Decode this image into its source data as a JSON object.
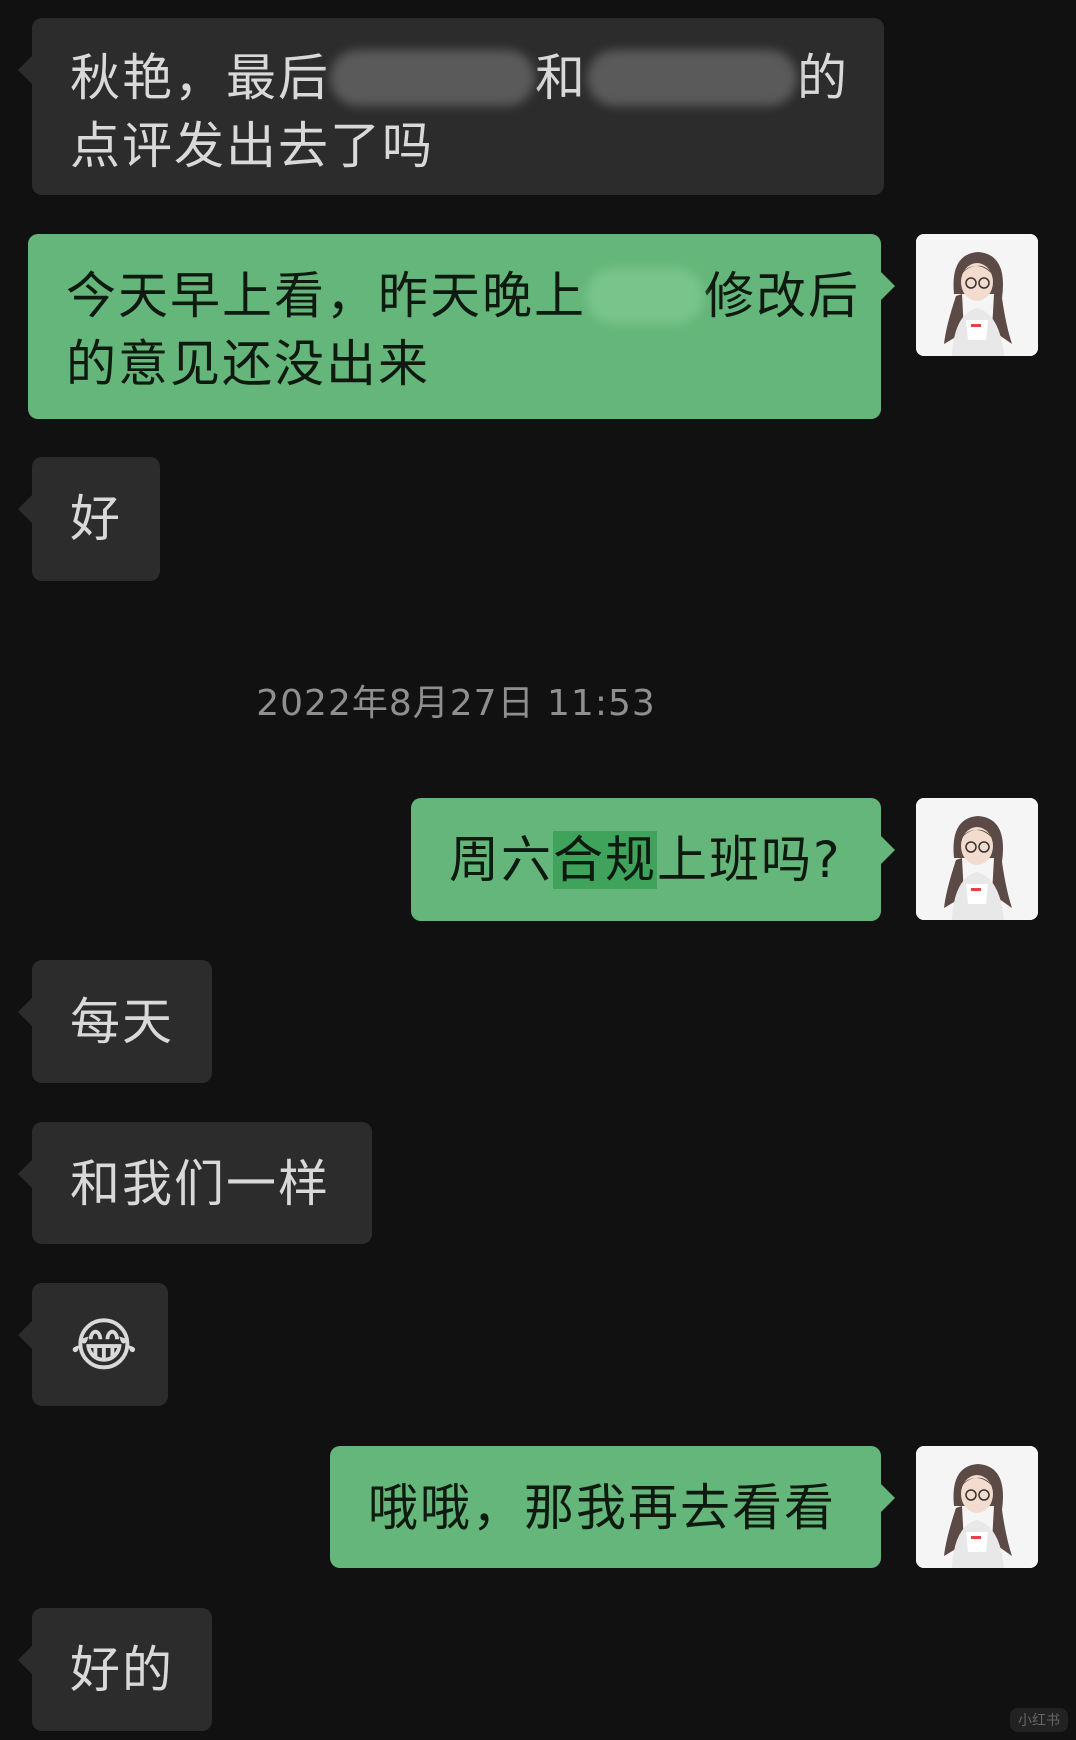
{
  "chat": {
    "messages": [
      {
        "side": "in",
        "part1": "秋艳，最后",
        "part2": "和",
        "part3": "的",
        "line2": "点评发出去了吗"
      },
      {
        "side": "out",
        "part1": "今天早上看，昨天晚上",
        "part2": "修改后",
        "line2": "的意见还没出来"
      },
      {
        "side": "in",
        "text": "好"
      },
      {
        "side": "out",
        "part1": "周六",
        "highlight": "合规",
        "part2": "上班吗?"
      },
      {
        "side": "in",
        "text": "每天"
      },
      {
        "side": "in",
        "text": "和我们一样"
      },
      {
        "side": "in",
        "emoji": "😂",
        "emoji_name": "tears-of-joy"
      },
      {
        "side": "out",
        "text": "哦哦，那我再去看看"
      },
      {
        "side": "in",
        "text": "好的"
      }
    ],
    "timestamp": "2022年8月27日 11:53"
  },
  "colors": {
    "background": "#111111",
    "incoming_bubble": "#2c2c2c",
    "outgoing_bubble": "#65b67a",
    "highlight": "#3fa35b",
    "timestamp_text": "#8f8f8f"
  },
  "watermark": "小红书"
}
